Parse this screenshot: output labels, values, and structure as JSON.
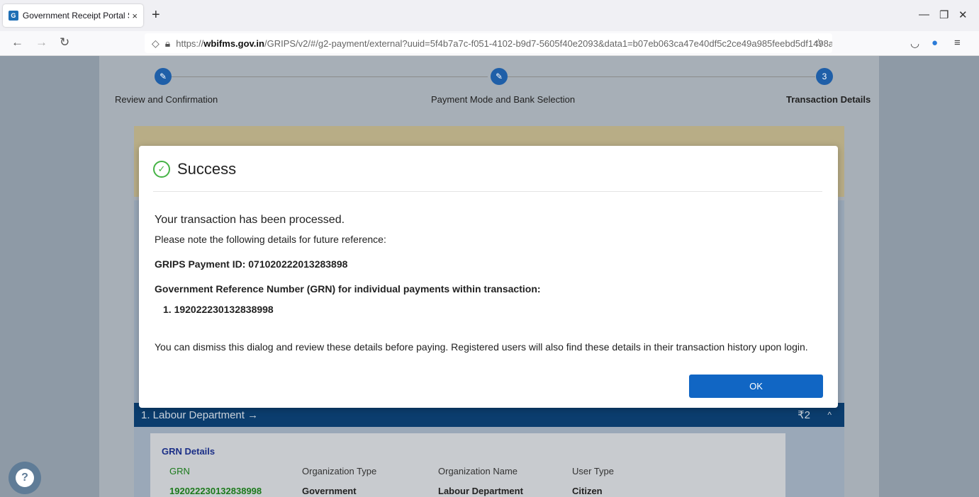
{
  "browser": {
    "tab_title": "Government Receipt Portal Syst",
    "tab_favicon": "G",
    "tab_close": "×",
    "new_tab": "+",
    "url_domain": "wbifms.gov.in",
    "url_prefix": "https://",
    "url_rest": "/GRIPS/v2/#/g2-payment/external?uuid=5f4b7a7c-f051-4102-b9d7-5605f40e2093&data1=b07eb063ca47e40df5c2ce49a985feebd5df1498a",
    "icons": [
      "back-icon",
      "forward-icon",
      "reload-icon",
      "shield-icon",
      "lock-icon",
      "star-icon",
      "pocket-icon",
      "extension-icon",
      "menu-icon"
    ]
  },
  "steps": [
    {
      "label": "Review and Confirmation",
      "marker": "✎"
    },
    {
      "label": "Payment Mode and Bank Selection",
      "marker": "✎"
    },
    {
      "label": "Transaction Details",
      "marker": "3"
    }
  ],
  "department": {
    "title": "1. Labour Department →",
    "amount": "₹2",
    "chevron": "^"
  },
  "grn_details": {
    "heading": "GRN Details",
    "headers": [
      "GRN",
      "Organization Type",
      "Organization Name",
      "User Type"
    ],
    "values": [
      "192022230132838998",
      "Government",
      "Labour Department",
      "Citizen"
    ]
  },
  "modal": {
    "title": "Success",
    "line1": "Your transaction has been processed.",
    "line2": "Please note the following details for future reference:",
    "payment_id": "GRIPS Payment ID: 071020222013283898",
    "grn_heading": "Government Reference Number (GRN) for individual payments within transaction:",
    "grn_item": "1. 192022230132838998",
    "footer": "You can dismiss this dialog and review these details before paying. Registered users will also find these details in their transaction history upon login.",
    "ok_label": "OK"
  },
  "colors": {
    "primary": "#1166c4",
    "success": "#45b345",
    "dept_bar": "#0b3d6e"
  }
}
